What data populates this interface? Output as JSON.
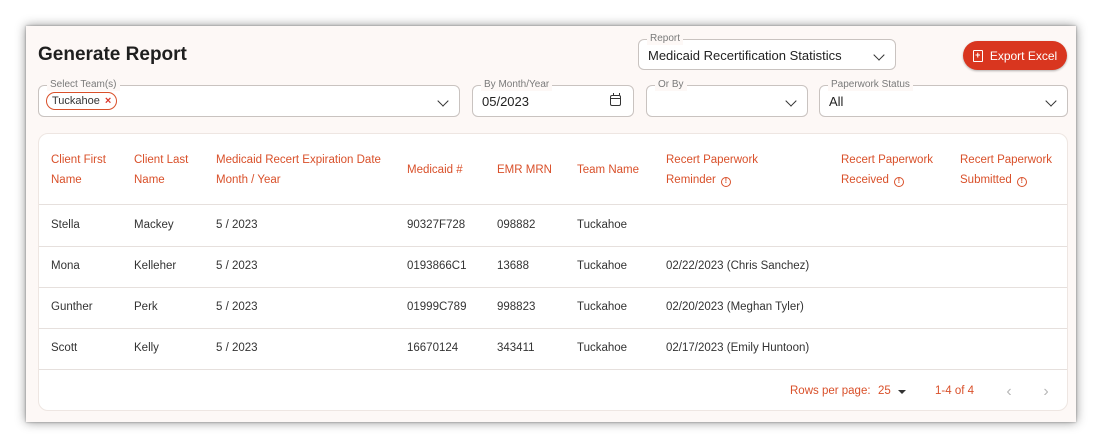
{
  "page": {
    "title": "Generate Report"
  },
  "report": {
    "label": "Report",
    "value": "Medicaid Recertification Statistics"
  },
  "export": {
    "label": "Export Excel"
  },
  "filters": {
    "team": {
      "label": "Select Team(s)",
      "chips": [
        "Tuckahoe"
      ]
    },
    "month": {
      "label": "By Month/Year",
      "value": "05/2023"
    },
    "orby": {
      "label": "Or By",
      "value": ""
    },
    "status": {
      "label": "Paperwork Status",
      "value": "All"
    }
  },
  "table": {
    "headers": [
      {
        "l1": "Client First",
        "l2": "Name",
        "info": false
      },
      {
        "l1": "Client Last",
        "l2": "Name",
        "info": false
      },
      {
        "l1": "Medicaid Recert Expiration Date",
        "l2": "Month / Year",
        "info": false
      },
      {
        "l1": "Medicaid #",
        "l2": "",
        "info": false
      },
      {
        "l1": "EMR MRN",
        "l2": "",
        "info": false
      },
      {
        "l1": "Team Name",
        "l2": "",
        "info": false
      },
      {
        "l1": "Recert Paperwork",
        "l2": "Reminder",
        "info": true
      },
      {
        "l1": "Recert Paperwork",
        "l2": "Received",
        "info": true
      },
      {
        "l1": "Recert Paperwork",
        "l2": "Submitted",
        "info": true
      }
    ],
    "rows": [
      [
        "Stella",
        "Mackey",
        "5 / 2023",
        "90327F728",
        "098882",
        "Tuckahoe",
        "",
        "",
        ""
      ],
      [
        "Mona",
        "Kelleher",
        "5 / 2023",
        "0193866C1",
        "13688",
        "Tuckahoe",
        "02/22/2023 (Chris Sanchez)",
        "",
        ""
      ],
      [
        "Gunther",
        "Perk",
        "5 / 2023",
        "01999C789",
        "998823",
        "Tuckahoe",
        "02/20/2023 (Meghan Tyler)",
        "",
        ""
      ],
      [
        "Scott",
        "Kelly",
        "5 / 2023",
        "16670124",
        "343411",
        "Tuckahoe",
        "02/17/2023 (Emily Huntoon)",
        "",
        ""
      ]
    ]
  },
  "pagination": {
    "rows_per_page_label": "Rows per page:",
    "rows_per_page": "25",
    "range": "1-4 of 4"
  },
  "icons": {
    "info": "info-icon",
    "calendar": "calendar-icon",
    "chevron": "chevron-down-icon",
    "file": "file-plus-icon",
    "remove": "close-icon",
    "prev": "chevron-left-icon",
    "next": "chevron-right-icon"
  },
  "colors": {
    "accent": "#d9502a",
    "button": "#d9361f"
  }
}
